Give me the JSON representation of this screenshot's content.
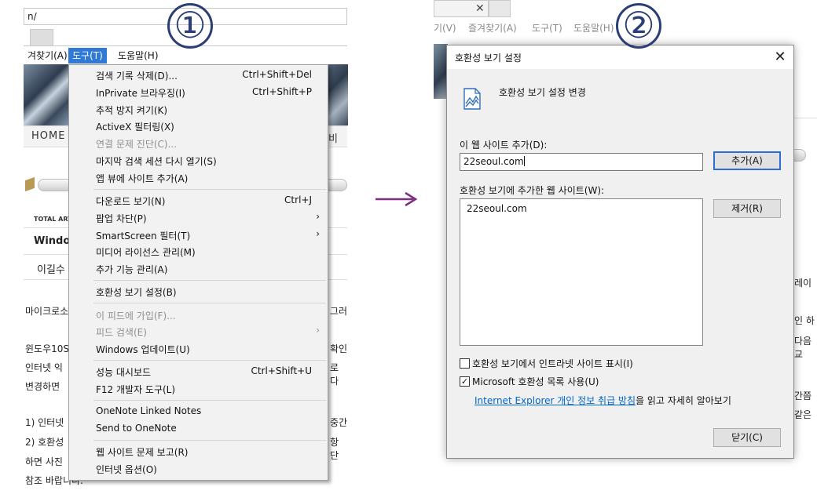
{
  "left": {
    "address_text": "n/",
    "menubar": [
      {
        "label": "겨찾기(A)",
        "active": false
      },
      {
        "label": "도구(T)",
        "active": true
      },
      {
        "label": "도움말(H)",
        "active": false
      }
    ],
    "callout": "①",
    "home_label": "HOME",
    "nav_right_fragment": "비",
    "total_label": "TOTAL ART",
    "post_title_fragment": "Windo",
    "author_fragment": "이길수",
    "body_lines_left": [
      "마이크로소",
      "윈도우10S",
      "인터넷 익",
      "변경하면 ",
      "1) 인터넷",
      "2) 호환성 ",
      "하면 사진",
      "참조 바랍니다."
    ],
    "body_lines_right": [
      "그러",
      "확인",
      "로 다",
      "중간",
      "항 단"
    ],
    "menu": {
      "groups": [
        [
          {
            "label": "검색 기록 삭제(D)...",
            "shortcut": "Ctrl+Shift+Del",
            "disabled": false,
            "submenu": false
          },
          {
            "label": "InPrivate 브라우징(I)",
            "shortcut": "Ctrl+Shift+P",
            "disabled": false,
            "submenu": false
          },
          {
            "label": "추적 방지 켜기(K)",
            "shortcut": "",
            "disabled": false,
            "submenu": false
          },
          {
            "label": "ActiveX 필터링(X)",
            "shortcut": "",
            "disabled": false,
            "submenu": false
          },
          {
            "label": "연결 문제 진단(C)...",
            "shortcut": "",
            "disabled": true,
            "submenu": false
          },
          {
            "label": "마지막 검색 세션 다시 열기(S)",
            "shortcut": "",
            "disabled": false,
            "submenu": false
          },
          {
            "label": "앱 뷰에 사이트 추가(A)",
            "shortcut": "",
            "disabled": false,
            "submenu": false
          }
        ],
        [
          {
            "label": "다운로드 보기(N)",
            "shortcut": "Ctrl+J",
            "disabled": false,
            "submenu": false
          },
          {
            "label": "팝업 차단(P)",
            "shortcut": "",
            "disabled": false,
            "submenu": true
          },
          {
            "label": "SmartScreen 필터(T)",
            "shortcut": "",
            "disabled": false,
            "submenu": true
          },
          {
            "label": "미디어 라이선스 관리(M)",
            "shortcut": "",
            "disabled": false,
            "submenu": false
          },
          {
            "label": "추가 기능 관리(A)",
            "shortcut": "",
            "disabled": false,
            "submenu": false
          }
        ],
        [
          {
            "label": "호환성 보기 설정(B)",
            "shortcut": "",
            "disabled": false,
            "submenu": false
          }
        ],
        [
          {
            "label": "이 피드에 가입(F)...",
            "shortcut": "",
            "disabled": true,
            "submenu": false
          },
          {
            "label": "피드 검색(E)",
            "shortcut": "",
            "disabled": true,
            "submenu": true
          },
          {
            "label": "Windows 업데이트(U)",
            "shortcut": "",
            "disabled": false,
            "submenu": false
          }
        ],
        [
          {
            "label": "성능 대시보드",
            "shortcut": "Ctrl+Shift+U",
            "disabled": false,
            "submenu": false
          },
          {
            "label": "F12 개발자 도구(L)",
            "shortcut": "",
            "disabled": false,
            "submenu": false
          }
        ],
        [
          {
            "label": "OneNote Linked Notes",
            "shortcut": "",
            "disabled": false,
            "submenu": false
          },
          {
            "label": "Send to OneNote",
            "shortcut": "",
            "disabled": false,
            "submenu": false
          }
        ],
        [
          {
            "label": "웹 사이트 문제 보고(R)",
            "shortcut": "",
            "disabled": false,
            "submenu": false
          },
          {
            "label": "인터넷 옵션(O)",
            "shortcut": "",
            "disabled": false,
            "submenu": false
          }
        ]
      ]
    }
  },
  "right": {
    "callout": "②",
    "menubar": [
      "기(V)",
      "즐겨찾기(A)",
      "도구(T)",
      "도움말(H)"
    ],
    "bg_fragments": [
      "레이",
      "인 하",
      "다음교",
      "간쯤",
      "같은"
    ],
    "dialog": {
      "title": "호환성 보기 설정",
      "heading": "호환성 보기 설정 변경",
      "add_label": "이 웹 사이트 추가(D):",
      "add_value": "22seoul.com",
      "add_button": "추가(A)",
      "list_label": "호환성 보기에 추가한 웹 사이트(W):",
      "sites": [
        "22seoul.com"
      ],
      "remove_button": "제거(R)",
      "checkbox_intranet": {
        "label": "호환성 보기에서 인트라넷 사이트 표시(I)",
        "checked": false
      },
      "checkbox_mslist": {
        "label": "Microsoft 호환성 목록 사용(U)",
        "checked": true
      },
      "privacy_link": "Internet Explorer 개인 정보 취급 방침",
      "privacy_suffix": "을 읽고 자세히 알아보기",
      "close_button": "닫기(C)"
    }
  },
  "colors": {
    "callout": "#2a3e75",
    "arrow": "#7b2f7d",
    "menu_active": "#2f7ad6",
    "primary_border": "#2c6fd1",
    "link": "#0066cc"
  }
}
